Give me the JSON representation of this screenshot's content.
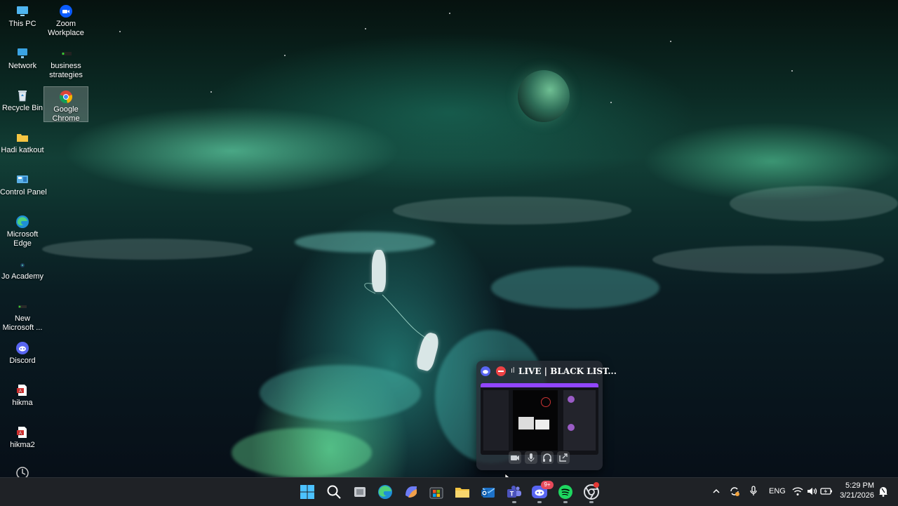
{
  "desktop": {
    "icons": [
      {
        "label": "This PC",
        "icon": "monitor-icon"
      },
      {
        "label": "Zoom Workplace",
        "icon": "zoom-icon"
      },
      {
        "label": "Network",
        "icon": "network-icon"
      },
      {
        "label": "business strategies",
        "icon": "shortcut-icon"
      },
      {
        "label": "Recycle Bin",
        "icon": "recycle-bin-icon"
      },
      {
        "label": "Google Chrome",
        "icon": "chrome-icon"
      },
      {
        "label": "Hadi katkout",
        "icon": "folder-icon"
      },
      {
        "label": "Control Panel",
        "icon": "control-panel-icon"
      },
      {
        "label": "Microsoft Edge",
        "icon": "edge-icon"
      },
      {
        "label": "Jo Academy",
        "icon": "app-icon"
      },
      {
        "label": "New Microsoft ...",
        "icon": "document-icon"
      },
      {
        "label": "Discord",
        "icon": "discord-icon"
      },
      {
        "label": "hikma",
        "icon": "pdf-icon"
      },
      {
        "label": "hikma2",
        "icon": "pdf-icon"
      },
      {
        "label": "",
        "icon": "app-icon"
      }
    ]
  },
  "overlay": {
    "title": "LIVE | BLACK LIST...",
    "controls": [
      "camera-icon",
      "microphone-icon",
      "headphones-icon",
      "disconnect-icon"
    ],
    "colors": {
      "discord": "#5865F2",
      "live": "#ED4245",
      "accent": "#9146FF"
    }
  },
  "taskbar": {
    "apps": [
      "windows-start-icon",
      "search-icon",
      "task-view-icon",
      "edge-icon",
      "copilot-icon",
      "store-icon",
      "file-explorer-icon",
      "outlook-icon",
      "teams-icon",
      "discord-icon",
      "spotify-icon",
      "chrome-icon"
    ],
    "discord_badge": "9+",
    "tray": {
      "language": "ENG",
      "time": "5:29 PM",
      "date": "3/21/2026"
    }
  }
}
